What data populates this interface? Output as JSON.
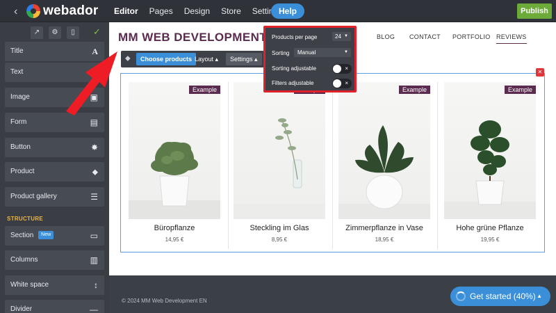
{
  "app": {
    "brand": "webador",
    "nav": [
      "Editor",
      "Pages",
      "Design",
      "Store",
      "Settings"
    ],
    "help_label": "Help",
    "publish_label": "Publish"
  },
  "sidebar": {
    "items": [
      {
        "label": "Title",
        "icon": "A"
      },
      {
        "label": "Text",
        "icon": "▤"
      },
      {
        "label": "Image",
        "icon": "▣"
      },
      {
        "label": "Form",
        "icon": "▤"
      },
      {
        "label": "Button",
        "icon": "✸"
      },
      {
        "label": "Product",
        "icon": "⬥"
      },
      {
        "label": "Product gallery",
        "icon": "☰"
      }
    ],
    "section_label": "STRUCTURE",
    "structure_items": [
      {
        "label": "Section",
        "badge": "New",
        "icon": "▭"
      },
      {
        "label": "Columns",
        "icon": "▥"
      },
      {
        "label": "White space",
        "icon": "↕"
      },
      {
        "label": "Divider",
        "icon": "—"
      }
    ]
  },
  "site": {
    "title": "MM WEB DEVELOPMENT EN",
    "nav": [
      "BLOG",
      "CONTACT",
      "PORTFOLIO",
      "REVIEWS"
    ],
    "active_nav": "REVIEWS"
  },
  "toolbar": {
    "choose_label": "Choose products",
    "layout_label": "Layout",
    "settings_label": "Settings"
  },
  "popup": {
    "per_page_label": "Products per page",
    "per_page_value": "24",
    "sorting_label": "Sorting",
    "sorting_value": "Manual",
    "sorting_adjustable_label": "Sorting adjustable",
    "filters_adjustable_label": "Filters adjustable"
  },
  "products": [
    {
      "badge": "Example",
      "name": "Büropflanze",
      "price": "14,95 €"
    },
    {
      "badge": "Example",
      "name": "Steckling im Glas",
      "price": "8,95 €"
    },
    {
      "badge": "Example",
      "name": "Zimmerpflanze in Vase",
      "price": "18,95 €"
    },
    {
      "badge": "Example",
      "name": "Hohe grüne Pflanze",
      "price": "19,95 €"
    }
  ],
  "footer": {
    "text": "© 2024 MM Web Development EN"
  },
  "get_started": {
    "label": "Get started (40%)"
  },
  "colors": {
    "accent": "#3b8fd9",
    "highlight": "#e0202a",
    "brand": "#5a2b4f",
    "publish": "#6cab3a"
  }
}
